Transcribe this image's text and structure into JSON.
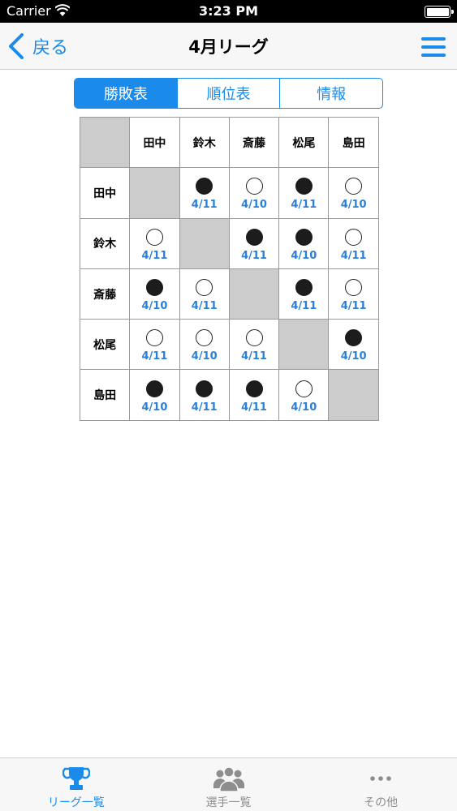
{
  "status": {
    "carrier": "Carrier",
    "time": "3:23 PM"
  },
  "nav": {
    "back_label": "戻る",
    "title": "4月リーグ"
  },
  "segments": [
    {
      "label": "勝敗表",
      "active": true
    },
    {
      "label": "順位表",
      "active": false
    },
    {
      "label": "情報",
      "active": false
    }
  ],
  "players": [
    "田中",
    "鈴木",
    "斎藤",
    "松尾",
    "島田"
  ],
  "results": [
    [
      null,
      {
        "mark": "loss",
        "date": "4/11"
      },
      {
        "mark": "win",
        "date": "4/10"
      },
      {
        "mark": "loss",
        "date": "4/11"
      },
      {
        "mark": "win",
        "date": "4/10"
      }
    ],
    [
      {
        "mark": "win",
        "date": "4/11"
      },
      null,
      {
        "mark": "loss",
        "date": "4/11"
      },
      {
        "mark": "loss",
        "date": "4/10"
      },
      {
        "mark": "win",
        "date": "4/11"
      }
    ],
    [
      {
        "mark": "loss",
        "date": "4/10"
      },
      {
        "mark": "win",
        "date": "4/11"
      },
      null,
      {
        "mark": "loss",
        "date": "4/11"
      },
      {
        "mark": "win",
        "date": "4/11"
      }
    ],
    [
      {
        "mark": "win",
        "date": "4/11"
      },
      {
        "mark": "win",
        "date": "4/10"
      },
      {
        "mark": "win",
        "date": "4/11"
      },
      null,
      {
        "mark": "loss",
        "date": "4/10"
      }
    ],
    [
      {
        "mark": "loss",
        "date": "4/10"
      },
      {
        "mark": "loss",
        "date": "4/11"
      },
      {
        "mark": "loss",
        "date": "4/11"
      },
      {
        "mark": "win",
        "date": "4/10"
      },
      null
    ]
  ],
  "tabs": [
    {
      "label": "リーグ一覧",
      "icon": "trophy-icon",
      "active": true
    },
    {
      "label": "選手一覧",
      "icon": "group-icon",
      "active": false
    },
    {
      "label": "その他",
      "icon": "more-icon",
      "active": false
    }
  ],
  "colors": {
    "accent": "#1a8bea",
    "date": "#2a7fd6",
    "self_cell": "#cccccc"
  }
}
